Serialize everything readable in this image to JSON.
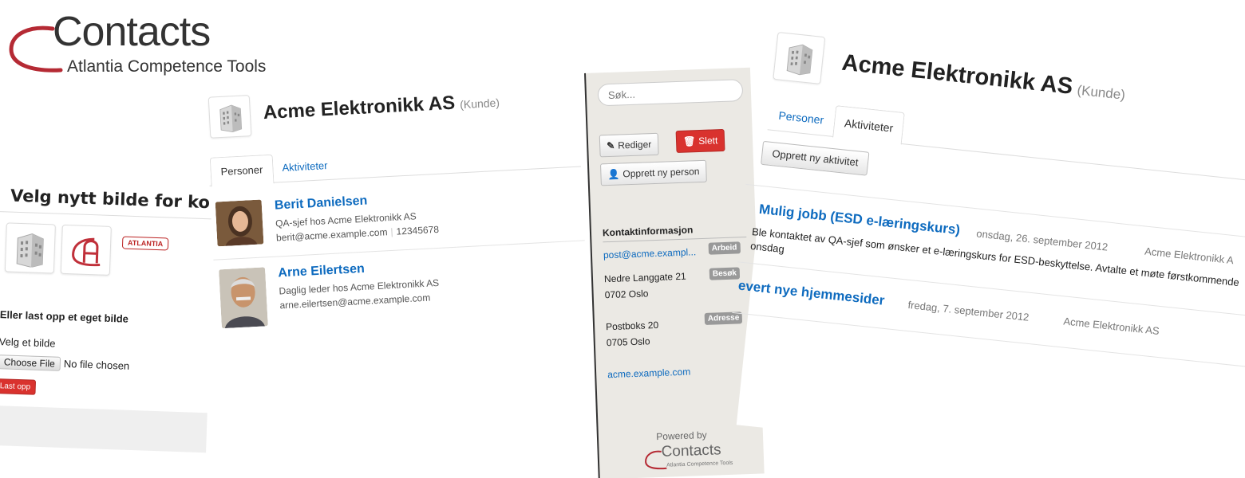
{
  "logo": {
    "title": "Contacts",
    "subtitle": "Atlantia Competence Tools",
    "accent_color": "#b52a34"
  },
  "picture_dialog": {
    "title": "Velg nytt bilde for konta",
    "thumbnails": [
      "building-icon",
      "atlantia-logo-icon",
      "atlantia-wordmark"
    ],
    "atlantia_wordmark": "ATLANTIA",
    "upload_heading": "Eller last opp et eget bilde",
    "choose_label": "Velg et bilde",
    "file_button": "Choose File",
    "file_status": "No file chosen",
    "upload_button": "Last opp"
  },
  "persons_view": {
    "company_name": "Acme Elektronikk AS",
    "company_kind": "(Kunde)",
    "tabs": [
      {
        "label": "Personer",
        "active": true
      },
      {
        "label": "Aktiviteter",
        "active": false
      }
    ],
    "persons": [
      {
        "name": "Berit Danielsen",
        "role": "QA-sjef hos Acme Elektronikk AS",
        "email": "berit@acme.example.com",
        "phone": "12345678"
      },
      {
        "name": "Arne Eilertsen",
        "role": "Daglig leder hos Acme Elektronikk AS",
        "email": "arne.eilertsen@acme.example.com",
        "phone": ""
      }
    ]
  },
  "sidebar": {
    "search_placeholder": "Søk...",
    "edit_button": "Rediger",
    "delete_button": "Slett",
    "create_person_button": "Opprett ny person",
    "contact_heading": "Kontaktinformasjon",
    "email": "post@acme.exampl...",
    "email_badge": "Arbeid",
    "visit_address_line1": "Nedre Langgate 21",
    "visit_address_line2": "0702 Oslo",
    "visit_badge": "Besøk",
    "postal_line1": "Postboks 20",
    "postal_line2": "0705 Oslo",
    "postal_badge": "Adresse",
    "website": "acme.example.com",
    "powered_by": "Powered by",
    "powered_logo_title": "Contacts",
    "powered_logo_sub": "Atlantia Competence Tools"
  },
  "activities_view": {
    "company_name": "Acme Elektronikk AS",
    "company_kind": "(Kunde)",
    "tabs": [
      {
        "label": "Personer",
        "active": false
      },
      {
        "label": "Aktiviteter",
        "active": true
      }
    ],
    "create_button": "Opprett ny aktivitet",
    "activities": [
      {
        "title": "Mulig jobb (ESD e-læringskurs)",
        "date": "onsdag, 26. september 2012",
        "company": "Acme Elektronikk A",
        "description": "Ble kontaktet av QA-sjef som ønsker et e-læringskurs for ESD-beskyttelse. Avtalte et møte førstkommende onsdag"
      },
      {
        "title": "evert nye hjemmesider",
        "date": "fredag, 7. september 2012",
        "company": "Acme Elektronikk AS",
        "description": ""
      }
    ]
  },
  "colors": {
    "link": "#0e6bbf",
    "danger": "#d9322e",
    "sidebar_bg": "#ebe9e4",
    "badge": "#999999"
  }
}
